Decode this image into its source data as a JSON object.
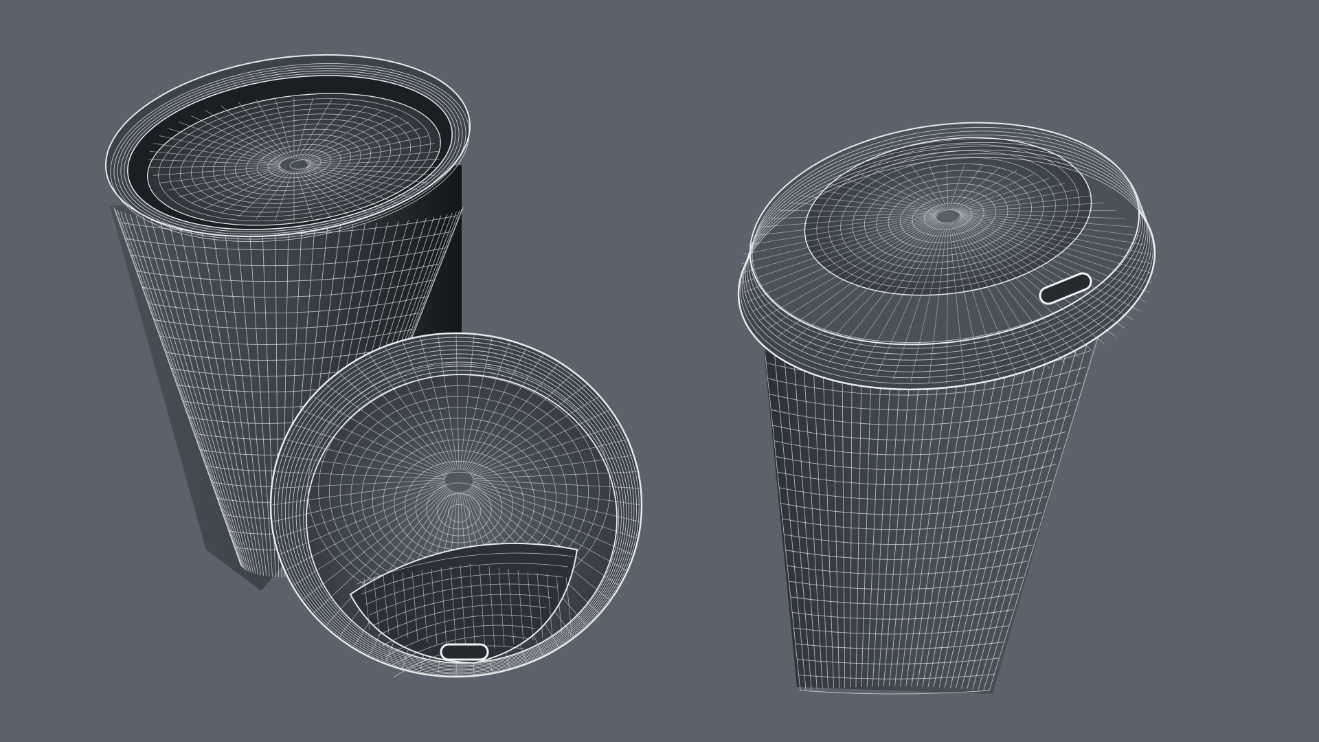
{
  "scene": {
    "background_color": "#5b626b",
    "mesh_fill_dark": "#1b1e22",
    "mesh_fill_mid": "#3b4148",
    "mesh_fill_light": "#6a727b",
    "wire_color": "#e8ebee",
    "objects": [
      {
        "name": "open-cup",
        "kind": "cup-without-lid"
      },
      {
        "name": "detached-lid",
        "kind": "lid-underside"
      },
      {
        "name": "lidded-cup",
        "kind": "cup-with-lid"
      }
    ]
  }
}
